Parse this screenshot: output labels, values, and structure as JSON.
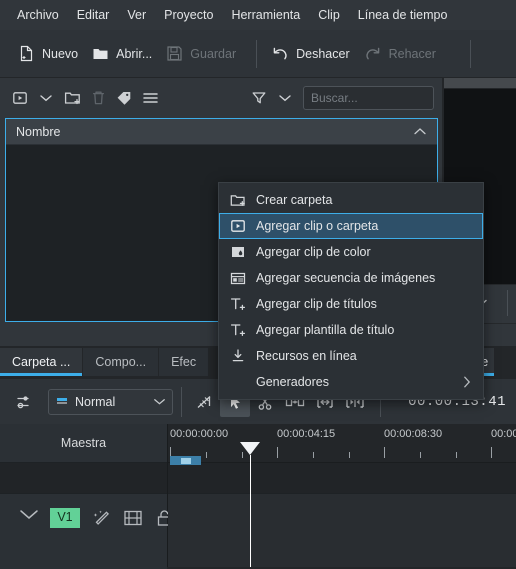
{
  "app": {
    "menubar": [
      {
        "label": "Archivo"
      },
      {
        "label": "Editar"
      },
      {
        "label": "Ver"
      },
      {
        "label": "Proyecto"
      },
      {
        "label": "Herramienta"
      },
      {
        "label": "Clip"
      },
      {
        "label": "Línea de tiempo"
      }
    ]
  },
  "toolbar": {
    "new_label": "Nuevo",
    "open_label": "Abrir...",
    "save_label": "Guardar",
    "undo_label": "Deshacer",
    "redo_label": "Rehacer"
  },
  "bin": {
    "search_placeholder": "Buscar...",
    "column_name": "Nombre",
    "icons": [
      "add-clip-icon",
      "chevron-down-icon",
      "new-folder-icon",
      "delete-icon",
      "tag-icon",
      "menu-icon",
      "filter-icon",
      "chevron-down-icon"
    ]
  },
  "tabs": {
    "left": [
      {
        "label": "Carpeta ...",
        "active": true
      },
      {
        "label": "Compo...",
        "active": false
      },
      {
        "label": "Efec",
        "active": false
      }
    ],
    "right": [
      {
        "label": "ctor de",
        "active": true
      }
    ]
  },
  "context_menu": {
    "items": [
      {
        "label": "Crear carpeta",
        "icon": "new-folder-icon",
        "selected": false,
        "submenu": false
      },
      {
        "label": "Agregar clip o carpeta",
        "icon": "add-clip-icon",
        "selected": true,
        "submenu": false
      },
      {
        "label": "Agregar clip de color",
        "icon": "color-clip-icon",
        "selected": false,
        "submenu": false
      },
      {
        "label": "Agregar secuencia de imágenes",
        "icon": "image-sequence-icon",
        "selected": false,
        "submenu": false
      },
      {
        "label": "Agregar clip de títulos",
        "icon": "title-clip-icon",
        "selected": false,
        "submenu": false
      },
      {
        "label": "Agregar plantilla de título",
        "icon": "title-template-icon",
        "selected": false,
        "submenu": false
      },
      {
        "label": "Recursos en línea",
        "icon": "download-icon",
        "selected": false,
        "submenu": false
      },
      {
        "label": "Generadores",
        "icon": "none",
        "selected": false,
        "submenu": true
      }
    ]
  },
  "timeline_toolbar": {
    "edit_mode": "Normal",
    "timecode": "00:00:13:41",
    "tools": [
      "timeline-settings-icon",
      "mix-icon",
      "selection-tool-icon",
      "razor-tool-icon",
      "spacer-tool-icon",
      "ripple-tool-icon",
      "roll-tool-icon"
    ]
  },
  "timeline": {
    "master_label": "Maestra",
    "ruler_labels": [
      "00:00:00:00",
      "00:00:04:15",
      "00:00:08:30",
      "00:00"
    ],
    "tracks": [
      {
        "name": "V1",
        "badge_color": "#62d197",
        "icons": [
          "chevron-down-icon",
          "effects-wand-icon",
          "video-strip-icon",
          "unlock-icon"
        ]
      }
    ]
  },
  "colors": {
    "accent": "#3daee9",
    "panel": "#31363b",
    "background": "#232629",
    "track_badge": "#62d197"
  }
}
